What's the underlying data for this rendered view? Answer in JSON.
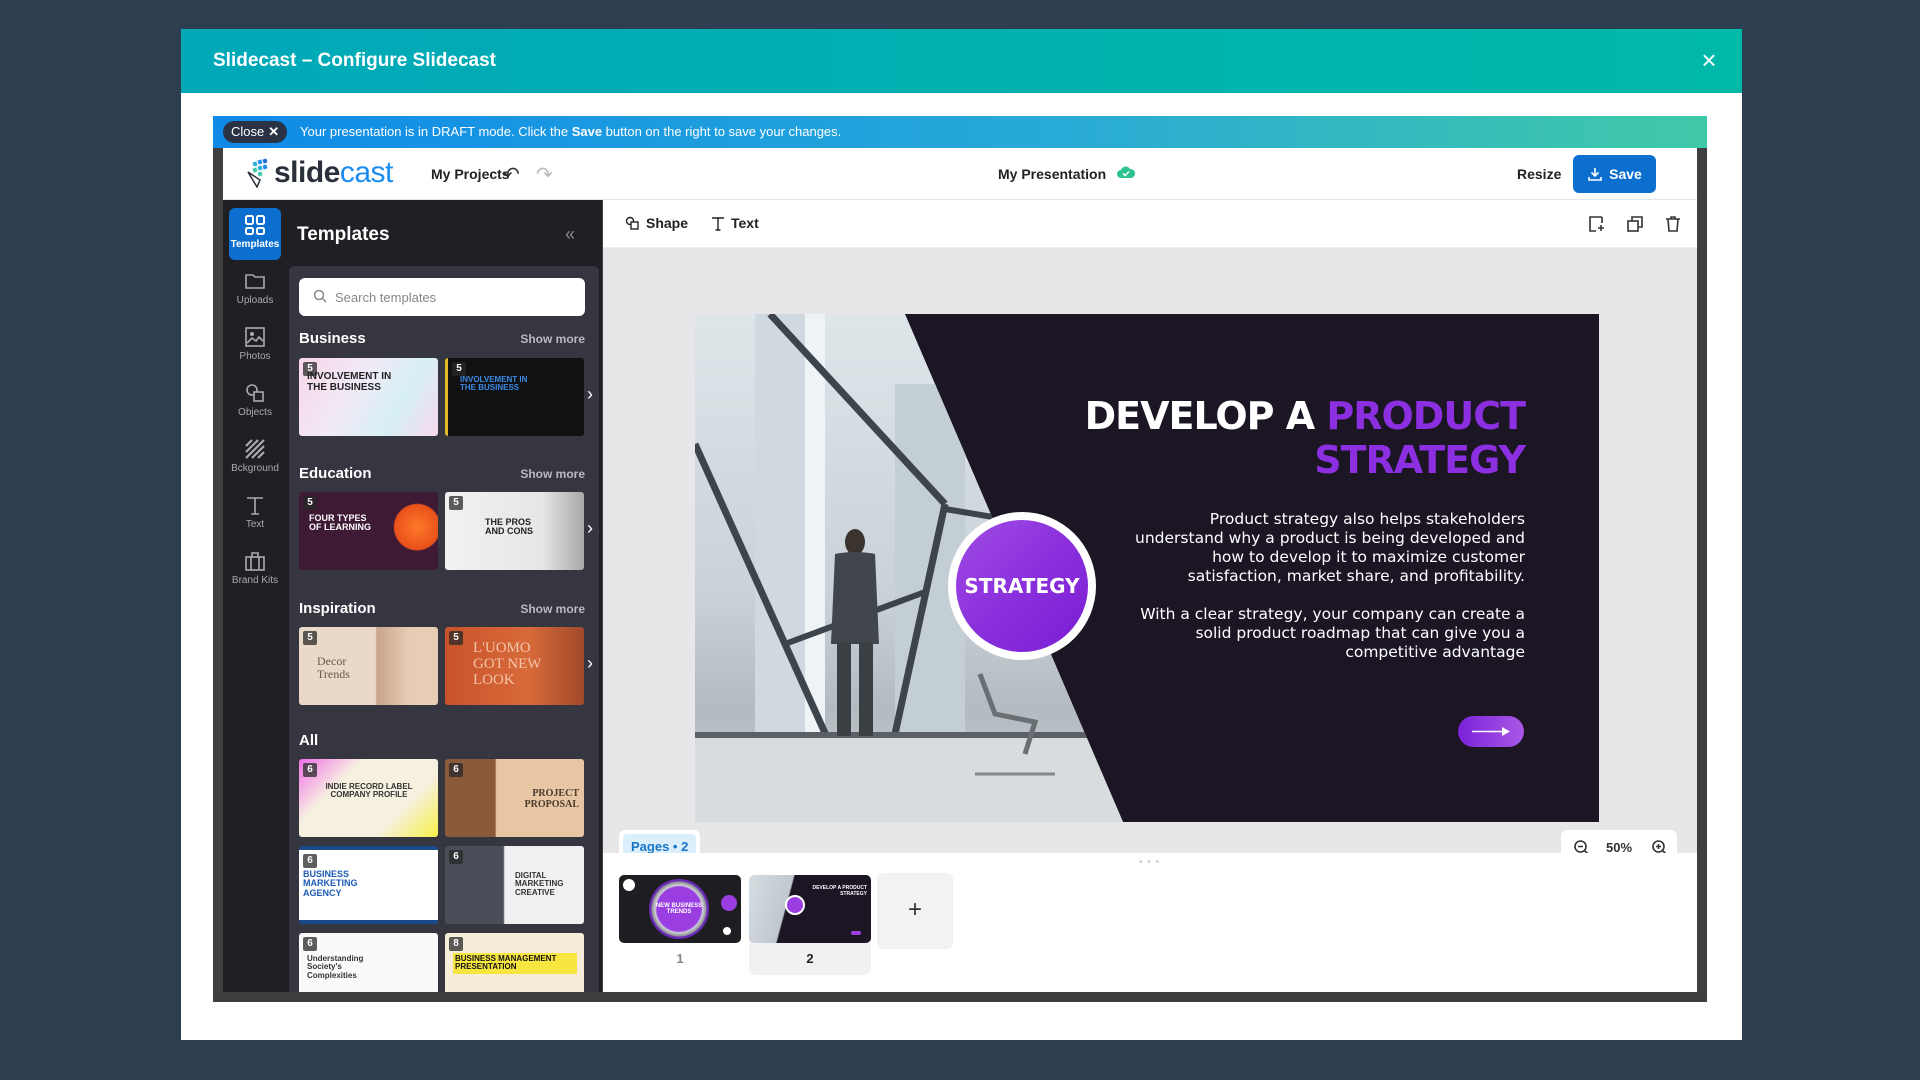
{
  "modal": {
    "title": "Slidecast – Configure Slidecast",
    "close_icon": "×"
  },
  "banner": {
    "close_label": "Close",
    "close_x": "✕",
    "text_before": "Your presentation is in DRAFT mode. Click the ",
    "text_bold": "Save",
    "text_after": " button on the right to save your changes."
  },
  "topbar": {
    "logo_part1": "slide",
    "logo_part2": "cast",
    "my_projects": "My Projects",
    "undo_icon": "↶",
    "redo_icon": "↷",
    "presentation_title": "My Presentation",
    "resize": "Resize",
    "save": "Save"
  },
  "rail": {
    "items": [
      {
        "label": "Templates",
        "icon": "grid-icon",
        "active": true
      },
      {
        "label": "Uploads",
        "icon": "folder-icon"
      },
      {
        "label": "Photos",
        "icon": "image-icon"
      },
      {
        "label": "Objects",
        "icon": "shapes-icon"
      },
      {
        "label": "Bckground",
        "icon": "hatch-icon"
      },
      {
        "label": "Text",
        "icon": "text-icon"
      },
      {
        "label": "Brand Kits",
        "icon": "briefcase-icon"
      }
    ]
  },
  "panel": {
    "title": "Templates",
    "collapse_icon": "«",
    "search_placeholder": "Search templates",
    "show_more": "Show more",
    "chevron": "›",
    "sections": [
      {
        "title": "Business",
        "templates": [
          {
            "badge": "5",
            "title": "INVOLVEMENT IN THE BUSINESS"
          },
          {
            "badge": "5",
            "title": "INVOLVEMENT IN THE BUSINESS"
          }
        ]
      },
      {
        "title": "Education",
        "templates": [
          {
            "badge": "5",
            "title": "FOUR TYPES OF LEARNING"
          },
          {
            "badge": "5",
            "title": "THE PROS AND CONS"
          }
        ]
      },
      {
        "title": "Inspiration",
        "templates": [
          {
            "badge": "5",
            "title": "Decor Trends"
          },
          {
            "badge": "5",
            "title": "L'UOMO GOT NEW LOOK"
          }
        ]
      },
      {
        "title": "All",
        "templates": [
          {
            "badge": "6",
            "title": "INDIE RECORD LABEL COMPANY PROFILE"
          },
          {
            "badge": "6",
            "title": "PROJECT PROPOSAL"
          },
          {
            "badge": "6",
            "title": "BUSINESS MARKETING AGENCY"
          },
          {
            "badge": "6",
            "title": "DIGITAL MARKETING CREATIVE"
          },
          {
            "badge": "6",
            "title": "Understanding Society's Complexities"
          },
          {
            "badge": "8",
            "title": "BUSINESS MANAGEMENT PRESENTATION"
          }
        ]
      }
    ]
  },
  "toolbar": {
    "shape": "Shape",
    "text": "Text"
  },
  "slide": {
    "title_white": "DEVELOP A ",
    "title_purple_1": "PRODUCT",
    "title_purple_2": "STRATEGY",
    "badge": "STRATEGY",
    "paragraph_1": "Product strategy also helps stakeholders understand why a product is being developed and how to develop it to maximize customer satisfaction, market share, and profitability.",
    "paragraph_2": "With a clear strategy, your company can create a solid product roadmap that can give you a competitive advantage"
  },
  "canvas": {
    "pages_label": "Pages • 2",
    "zoom_value": "50%"
  },
  "filmstrip": {
    "dots": "• • •",
    "pages": [
      {
        "number": "1",
        "title": "NEW BUSINESS TRENDS"
      },
      {
        "number": "2",
        "title": "DEVELOP A PRODUCT STRATEGY",
        "selected": true
      }
    ],
    "add_label": "+"
  },
  "colors": {
    "header_teal": "#00b2b0",
    "save_blue": "#0c6fcf",
    "slide_purple": "#8b2fe0",
    "slide_bg": "#1b1524",
    "background": "#2d3e50"
  }
}
